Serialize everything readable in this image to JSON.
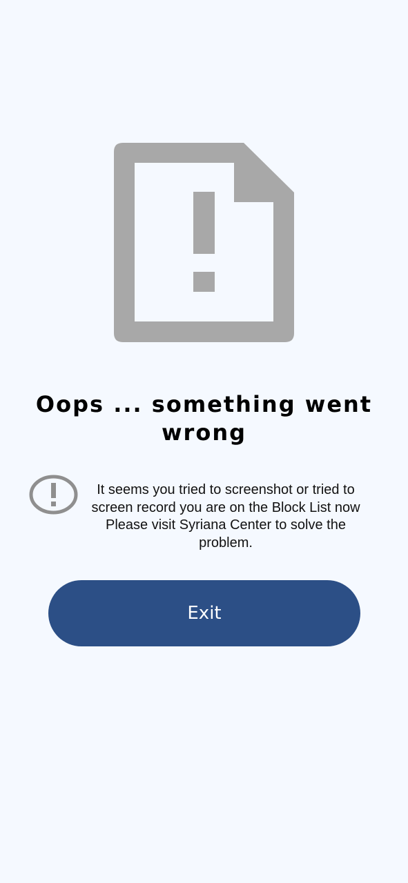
{
  "error": {
    "title": "Oops ... something went wrong",
    "message_lines": [
      "It seems you tried to screenshot or tried to",
      "screen record you are on the Block List now",
      "Please visit Syriana Center to solve the",
      "problem."
    ]
  },
  "actions": {
    "exit_label": "Exit"
  },
  "icons": {
    "hero": "document-alert-icon",
    "notice": "alert-circle-icon"
  },
  "colors": {
    "background": "#f5f9ff",
    "icon_gray": "#a8a8a8",
    "notice_icon_gray": "#8f8f8f",
    "button_primary": "#2c4f86",
    "button_text": "#ffffff",
    "title_text": "#000000"
  }
}
